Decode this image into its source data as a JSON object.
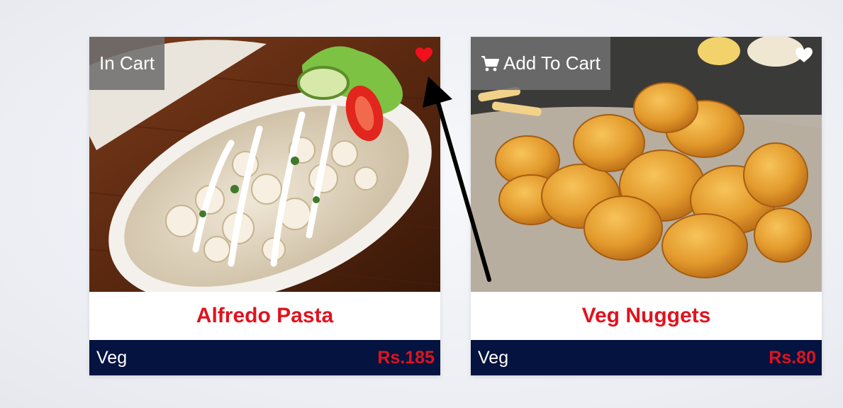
{
  "products": [
    {
      "name": "Alfredo Pasta",
      "category": "Veg",
      "price": "Rs.185",
      "cart_label": "In Cart",
      "in_cart": true,
      "favorited": true,
      "heart_color": "#f2101c"
    },
    {
      "name": "Veg Nuggets",
      "category": "Veg",
      "price": "Rs.80",
      "cart_label": "Add To Cart",
      "cart_icon": "cart-icon",
      "in_cart": false,
      "favorited": false,
      "heart_color": "#ffffff"
    }
  ],
  "colors": {
    "title_red": "#e0131e",
    "footer_navy": "#04133f",
    "tag_gray": "#6e6e6e",
    "arrow": "#000000"
  }
}
